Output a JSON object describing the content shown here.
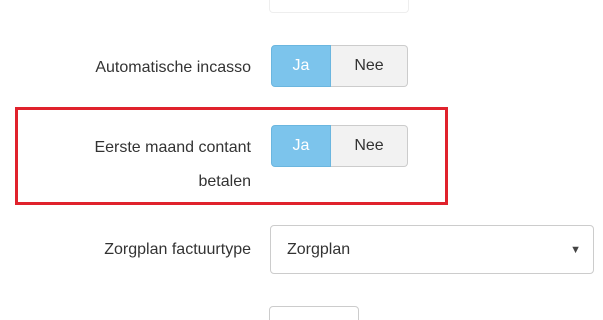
{
  "form": {
    "automatische_incasso": {
      "label": "Automatische incasso",
      "yes_label": "Ja",
      "no_label": "Nee",
      "selected": "Ja"
    },
    "eerste_maand_contant": {
      "label_line1": "Eerste maand contant",
      "label_line2": "betalen",
      "yes_label": "Ja",
      "no_label": "Nee",
      "selected": "Ja"
    },
    "zorgplan_factuurtype": {
      "label": "Zorgplan factuurtype",
      "value": "Zorgplan",
      "caret": "▼"
    }
  },
  "colors": {
    "active_button": "#7cc4ec",
    "inactive_button": "#f2f2f2",
    "highlight_border": "#e0222c"
  }
}
